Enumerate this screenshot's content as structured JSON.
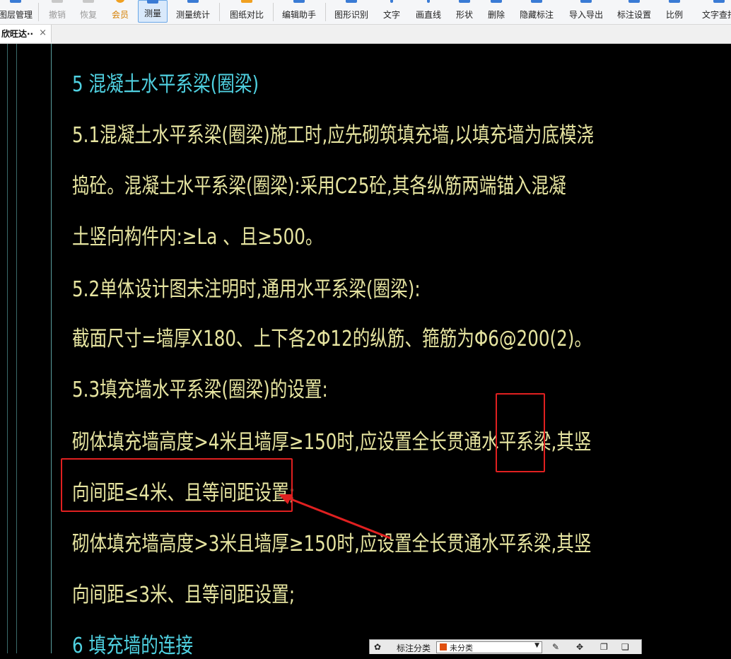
{
  "toolbar": {
    "items": [
      {
        "label": "图层管理"
      },
      {
        "label": "撤销"
      },
      {
        "label": "恢复"
      },
      {
        "label": "会员"
      },
      {
        "label": "测量"
      },
      {
        "label": "测量统计"
      },
      {
        "label": "图纸对比"
      },
      {
        "label": "编辑助手"
      },
      {
        "label": "图形识别"
      },
      {
        "label": "文字"
      },
      {
        "label": "画直线"
      },
      {
        "label": "形状"
      },
      {
        "label": "删除"
      },
      {
        "label": "隐藏标注"
      },
      {
        "label": "导入导出"
      },
      {
        "label": "标注设置"
      },
      {
        "label": "比例"
      },
      {
        "label": "文字查找"
      }
    ]
  },
  "tab": {
    "label": "欣旺达··",
    "close": "×"
  },
  "drawing": {
    "lines": [
      "5   混凝土水平系梁(圈梁)",
      "5.1混凝土水平系梁(圈梁)施工时,应先砌筑填充墙,以填充墙为底模浇",
      "捣砼。混凝土水平系梁(圈梁):采用C25砼,其各纵筋两端锚入混凝",
      "土竖向构件内:≥La 、且≥500。",
      "5.2单体设计图未注明时,通用水平系梁(圈梁):",
      "截面尺寸=墙厚X180、上下各2Φ12的纵筋、箍筋为Φ6@200(2)。",
      "5.3填充墙水平系梁(圈梁)的设置:",
      "砌体填充墙高度>4米且墙厚≥150时,应设置全长贯通水平系梁,其竖",
      "向间距≤4米、且等间距设置;",
      "砌体填充墙高度>3米且墙厚≥150时,应设置全长贯通水平系梁,其竖",
      "向间距≤3米、且等间距设置;",
      "6   填充墙的连接"
    ]
  },
  "floatbar": {
    "label": "标注分类",
    "selected": "未分类"
  },
  "colors": {
    "text": "#e6e4a0",
    "heading": "#4fd0e0",
    "highlight": "#e02020"
  }
}
